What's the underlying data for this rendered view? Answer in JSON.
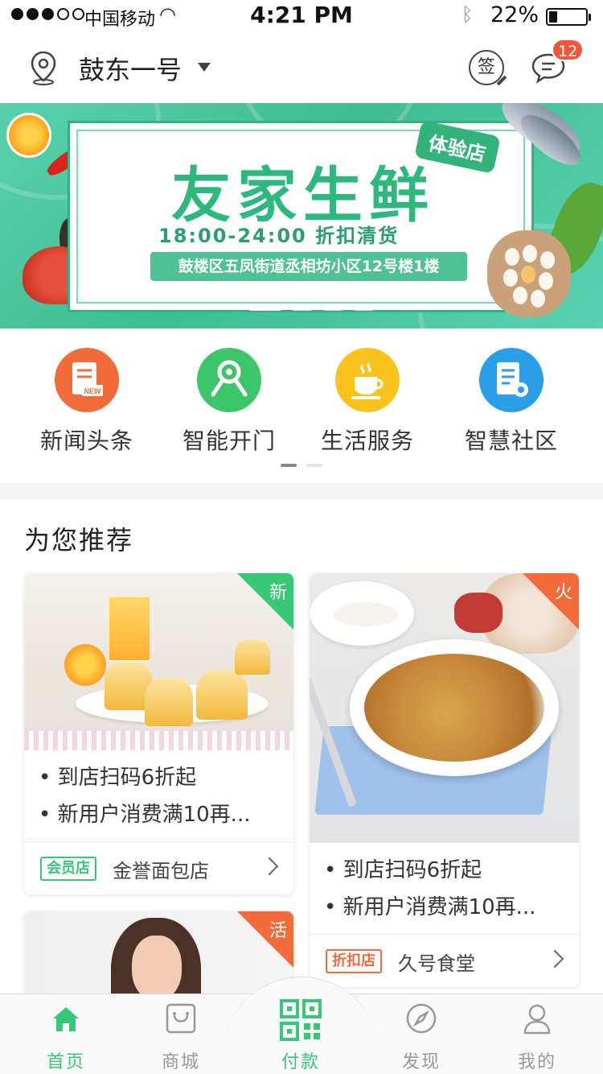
{
  "status_bar": {
    "carrier": "中国移动",
    "time": "4:21 PM",
    "battery": "22%"
  },
  "header": {
    "location": "鼓东一号",
    "sign_label": "签",
    "message_count": "12"
  },
  "banner": {
    "title": "友家生鲜",
    "tag": "体验店",
    "hours": "18:00-24:00 折扣清货",
    "address": "鼓楼区五凤街道丞相坊小区12号楼1楼"
  },
  "quick_menu": [
    {
      "label": "新闻头条",
      "icon": "news-icon",
      "color": "#f26b3a"
    },
    {
      "label": "智能开门",
      "icon": "key-icon",
      "color": "#3dc56b"
    },
    {
      "label": "生活服务",
      "icon": "coffee-icon",
      "color": "#f7c31c"
    },
    {
      "label": "智慧社区",
      "icon": "community-icon",
      "color": "#2b9ee8"
    }
  ],
  "recommend": {
    "title": "为您推荐",
    "cards": [
      {
        "ribbon": "新",
        "ribbon_color": "#38c776",
        "bullet1": "• 到店扫码6折起",
        "bullet2": "• 新用户消费满10再...",
        "badge": "会员店",
        "badge_color": "#38c776",
        "shop": "金誉面包店"
      },
      {
        "ribbon": "火",
        "ribbon_color": "#f26b3a",
        "bullet1": "• 到店扫码6折起",
        "bullet2": "• 新用户消费满10再...",
        "badge": "折扣店",
        "badge_color": "#f26b3a",
        "shop": "久号食堂"
      },
      {
        "ribbon": "活",
        "ribbon_color": "#f26b3a"
      }
    ]
  },
  "tabbar": [
    {
      "label": "首页",
      "icon": "home-icon"
    },
    {
      "label": "商城",
      "icon": "shop-icon"
    },
    {
      "label": "付款",
      "icon": "qrcode-icon"
    },
    {
      "label": "发现",
      "icon": "compass-icon"
    },
    {
      "label": "我的",
      "icon": "profile-icon"
    }
  ],
  "colors": {
    "accent": "#38c776",
    "hot": "#f26b3a",
    "badge_red": "#f4553a"
  }
}
